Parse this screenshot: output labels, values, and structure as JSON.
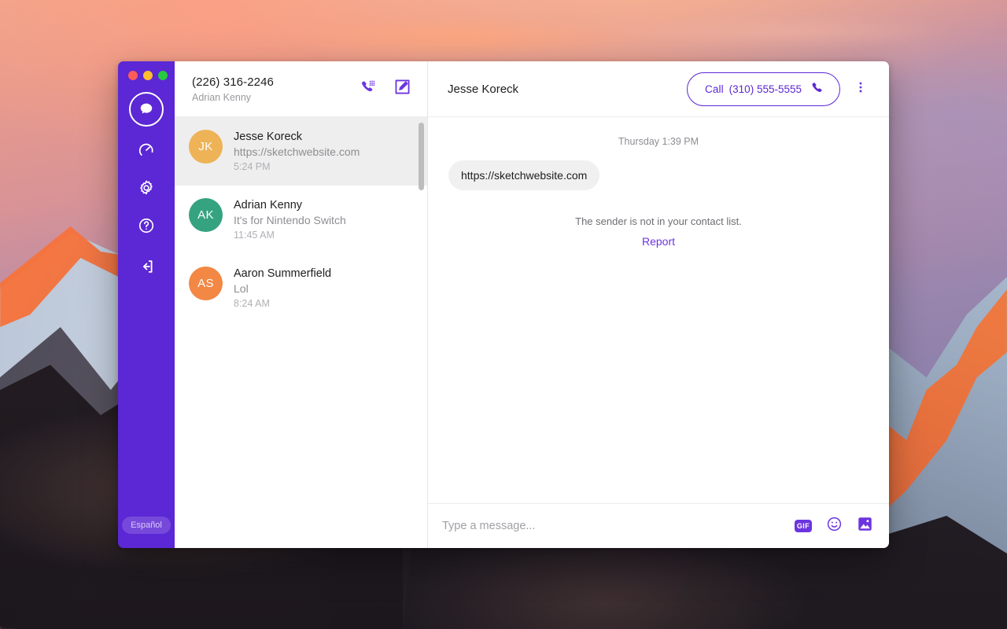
{
  "window": {
    "traffic_lights": [
      {
        "name": "close",
        "color": "#fc5b57"
      },
      {
        "name": "minimize",
        "color": "#fdbd2e"
      },
      {
        "name": "maximize",
        "color": "#28c840"
      }
    ]
  },
  "theme": {
    "brand_purple": "#5c27d4",
    "link_purple": "#6c34e0",
    "selected_row_bg": "#eeeeee",
    "bubble_in_bg": "#f0f0f0"
  },
  "nav_rail": {
    "items": [
      {
        "icon": "chat-bubble-icon",
        "label": "Messages",
        "active": true
      },
      {
        "icon": "speedometer-icon",
        "label": "Dashboard",
        "active": false
      },
      {
        "icon": "gear-icon",
        "label": "Settings",
        "active": false
      },
      {
        "icon": "help-circle-icon",
        "label": "Help",
        "active": false
      },
      {
        "icon": "sign-out-icon",
        "label": "Sign out",
        "active": false
      }
    ],
    "language_button": "Español"
  },
  "conversation_panel": {
    "header": {
      "phone_number": "(226) 316-2246",
      "account_name": "Adrian Kenny",
      "actions": [
        {
          "icon": "dialpad-phone-icon",
          "label": "Dialpad"
        },
        {
          "icon": "compose-icon",
          "label": "New message"
        }
      ]
    },
    "conversations": [
      {
        "initials": "JK",
        "avatar_color": "#edb356",
        "name": "Jesse Koreck",
        "preview": "https://sketchwebsite.com",
        "time": "5:24 PM",
        "selected": true
      },
      {
        "initials": "AK",
        "avatar_color": "#35a37f",
        "name": "Adrian Kenny",
        "preview": "It's for Nintendo Switch",
        "time": "11:45 AM",
        "selected": false
      },
      {
        "initials": "AS",
        "avatar_color": "#f28844",
        "name": "Aaron Summerfield",
        "preview": "Lol",
        "time": "8:24 AM",
        "selected": false
      }
    ]
  },
  "thread_panel": {
    "title": "Jesse Koreck",
    "call_button": {
      "label": "Call",
      "number": "(310) 555-5555",
      "icon": "phone-icon"
    },
    "more_button_icon": "dots-vertical-icon",
    "timestamp": "Thursday 1:39 PM",
    "messages": [
      {
        "direction": "incoming",
        "text": "https://sketchwebsite.com"
      }
    ],
    "sender_notice": "The sender is not in your contact list.",
    "report_link": "Report",
    "composer": {
      "placeholder": "Type a message...",
      "value": "",
      "actions": [
        {
          "icon": "gif-icon",
          "label": "GIF"
        },
        {
          "icon": "emoji-icon",
          "label": "Emoji"
        },
        {
          "icon": "image-icon",
          "label": "Attach image"
        }
      ]
    }
  }
}
